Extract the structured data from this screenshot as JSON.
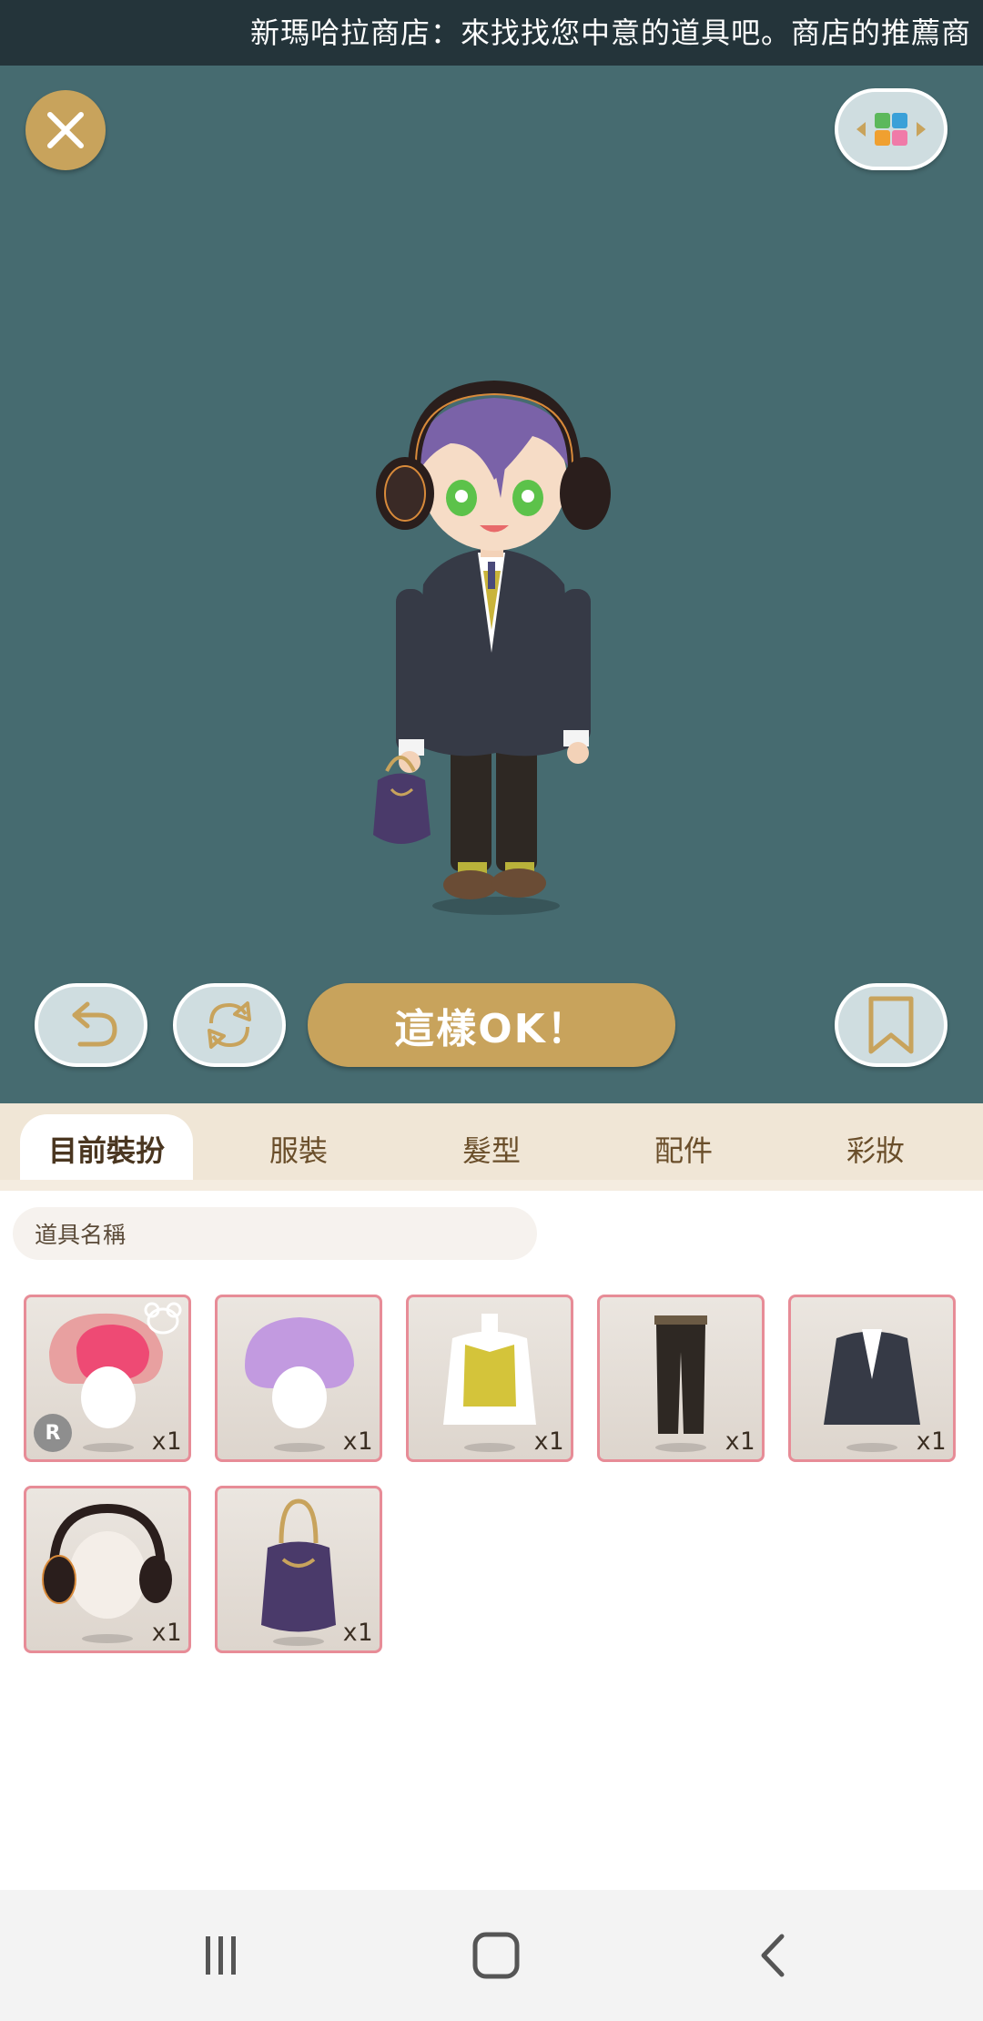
{
  "ticker": {
    "text": "新瑪哈拉商店：來找找您中意的道具吧。商店的推薦商"
  },
  "stage": {
    "close_icon": "close-icon",
    "layout_icon": "grid-layout-icon",
    "actions": {
      "undo_icon": "undo-icon",
      "rotate_icon": "rotate-icon",
      "confirm_label": "這樣OK！",
      "bookmark_icon": "bookmark-icon"
    }
  },
  "tabs": [
    {
      "label": "目前裝扮",
      "active": true
    },
    {
      "label": "服裝",
      "active": false
    },
    {
      "label": "髮型",
      "active": false
    },
    {
      "label": "配件",
      "active": false
    },
    {
      "label": "彩妝",
      "active": false
    }
  ],
  "search": {
    "placeholder": "道具名稱"
  },
  "items": [
    {
      "name": "pink-bun-hairstyle",
      "qty": "x1",
      "rank": "R"
    },
    {
      "name": "purple-curly-hairstyle",
      "qty": "x1"
    },
    {
      "name": "yellow-vest-shirt",
      "qty": "x1"
    },
    {
      "name": "black-trousers",
      "qty": "x1"
    },
    {
      "name": "navy-blazer",
      "qty": "x1"
    },
    {
      "name": "black-headphones",
      "qty": "x1"
    },
    {
      "name": "purple-drawstring-bag",
      "qty": "x1"
    }
  ],
  "colors": {
    "ticker_bg": "#24343a",
    "stage_bg": "#466b70",
    "accent_gold": "#c8a35c",
    "tab_bar_bg": "#f0e6d6",
    "item_border": "#e78c97"
  },
  "navbar": {
    "recents_icon": "recents-icon",
    "home_icon": "home-icon",
    "back_icon": "back-icon"
  }
}
